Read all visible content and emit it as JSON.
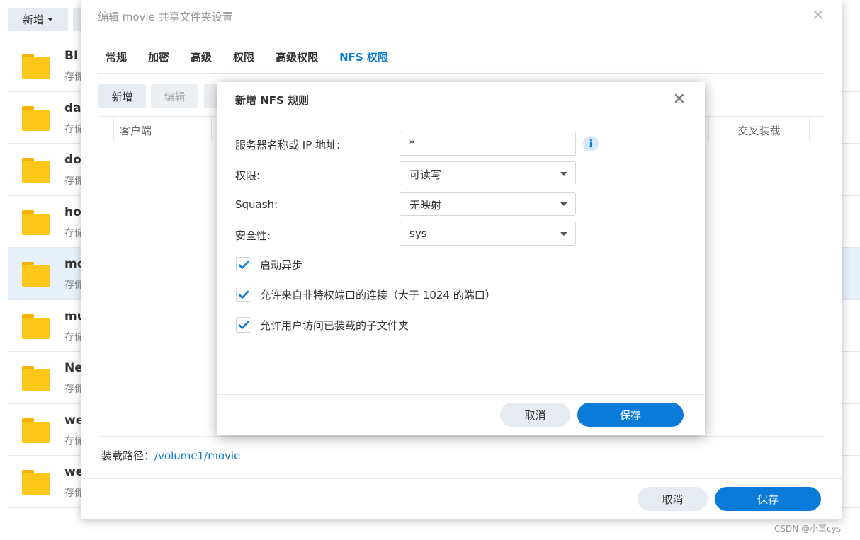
{
  "background": {
    "new_button": "新增",
    "rows": [
      {
        "name": "BI",
        "sub": "存储",
        "selected": false
      },
      {
        "name": "da",
        "sub": "存储",
        "selected": false
      },
      {
        "name": "do",
        "sub": "存储",
        "selected": false
      },
      {
        "name": "ho",
        "sub": "存储",
        "selected": false
      },
      {
        "name": "mo",
        "sub": "存储",
        "selected": true
      },
      {
        "name": "mu",
        "sub": "存储",
        "selected": false
      },
      {
        "name": "Ne",
        "sub": "存储",
        "selected": false
      },
      {
        "name": "we",
        "sub": "存储",
        "selected": false
      },
      {
        "name": "we",
        "sub": "存储",
        "selected": false
      }
    ]
  },
  "dialog": {
    "title": "编辑 movie 共享文件夹设置",
    "close_glyph": "✕",
    "tabs": [
      "常规",
      "加密",
      "高级",
      "权限",
      "高级权限",
      "NFS 权限"
    ],
    "active_tab_index": 5,
    "toolbar": {
      "new_label": "新增",
      "edit_label": "编辑"
    },
    "grid": {
      "col_client": "客户端",
      "col_cross_mount": "交叉装载"
    },
    "mount_label": "装载路径：",
    "mount_path": "/volume1/movie",
    "cancel_label": "取消",
    "save_label": "保存"
  },
  "nfs_dialog": {
    "title": "新增 NFS 规则",
    "close_glyph": "✕",
    "fields": {
      "host_label": "服务器名称或 IP 地址:",
      "host_value": "*",
      "privilege_label": "权限:",
      "privilege_value": "可读写",
      "squash_label": "Squash:",
      "squash_value": "无映射",
      "security_label": "安全性:",
      "security_value": "sys"
    },
    "checkboxes": [
      {
        "label": "启动异步",
        "checked": true
      },
      {
        "label": "允许来自非特权端口的连接（大于 1024 的端口）",
        "checked": true
      },
      {
        "label": "允许用户访问已装载的子文件夹",
        "checked": true
      }
    ],
    "cancel_label": "取消",
    "save_label": "保存",
    "info_glyph": "i"
  },
  "watermark": "CSDN @小草cys",
  "colors": {
    "accent": "#0a7bd8",
    "folder": "#ffc61a",
    "selected_row": "#e8f1fb"
  }
}
